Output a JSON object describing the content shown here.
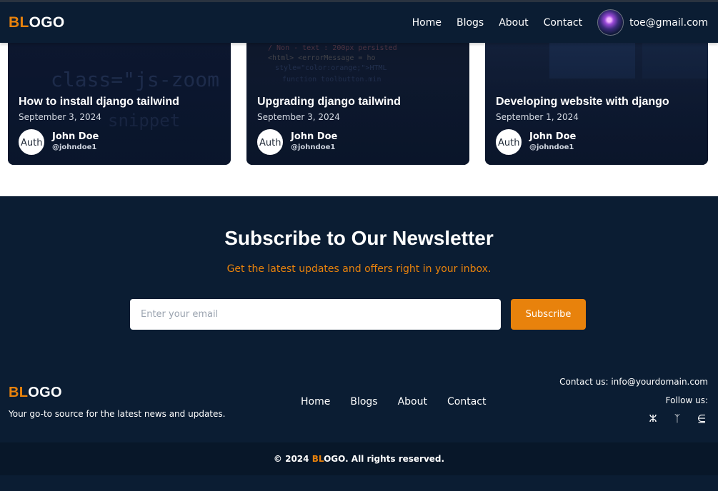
{
  "header": {
    "logo_accent": "BL",
    "logo_rest": "OGO",
    "nav": [
      "Home",
      "Blogs",
      "About",
      "Contact"
    ],
    "user_email": "toe@gmail.com"
  },
  "posts": [
    {
      "title": "How to install django tailwind",
      "date": "September 3, 2024",
      "author_img_alt": "Auth",
      "author_name": "John Doe",
      "author_handle": "@johndoe1"
    },
    {
      "title": "Upgrading django tailwind",
      "date": "September 3, 2024",
      "author_img_alt": "Auth",
      "author_name": "John Doe",
      "author_handle": "@johndoe1"
    },
    {
      "title": "Developing website with django",
      "date": "September 1, 2024",
      "author_img_alt": "Auth",
      "author_name": "John Doe",
      "author_handle": "@johndoe1"
    }
  ],
  "newsletter": {
    "title": "Subscribe to Our Newsletter",
    "subtitle": "Get the latest updates and offers right in your inbox.",
    "email_placeholder": "Enter your email",
    "email_value": "",
    "subscribe_label": "Subscribe"
  },
  "footer": {
    "logo_accent": "BL",
    "logo_rest": "OGO",
    "tagline": "Your go-to source for the latest news and updates.",
    "nav": [
      "Home",
      "Blogs",
      "About",
      "Contact"
    ],
    "contact": "Contact us: info@yourdomain.com",
    "follow": "Follow us:",
    "socials": [
      {
        "icon": "facebook-icon",
        "glyph": "ⵣ"
      },
      {
        "icon": "twitter-icon",
        "glyph": "ᛉ"
      },
      {
        "icon": "linkedin-icon",
        "glyph": "⋸"
      }
    ],
    "copyright_prefix": "© 2024 ",
    "copyright_accent": "BL",
    "copyright_brand": "OGO",
    "copyright_suffix": ". All rights reserved."
  },
  "colors": {
    "navy": "#0b1d33",
    "accent": "#e8820c",
    "white": "#ffffff"
  }
}
